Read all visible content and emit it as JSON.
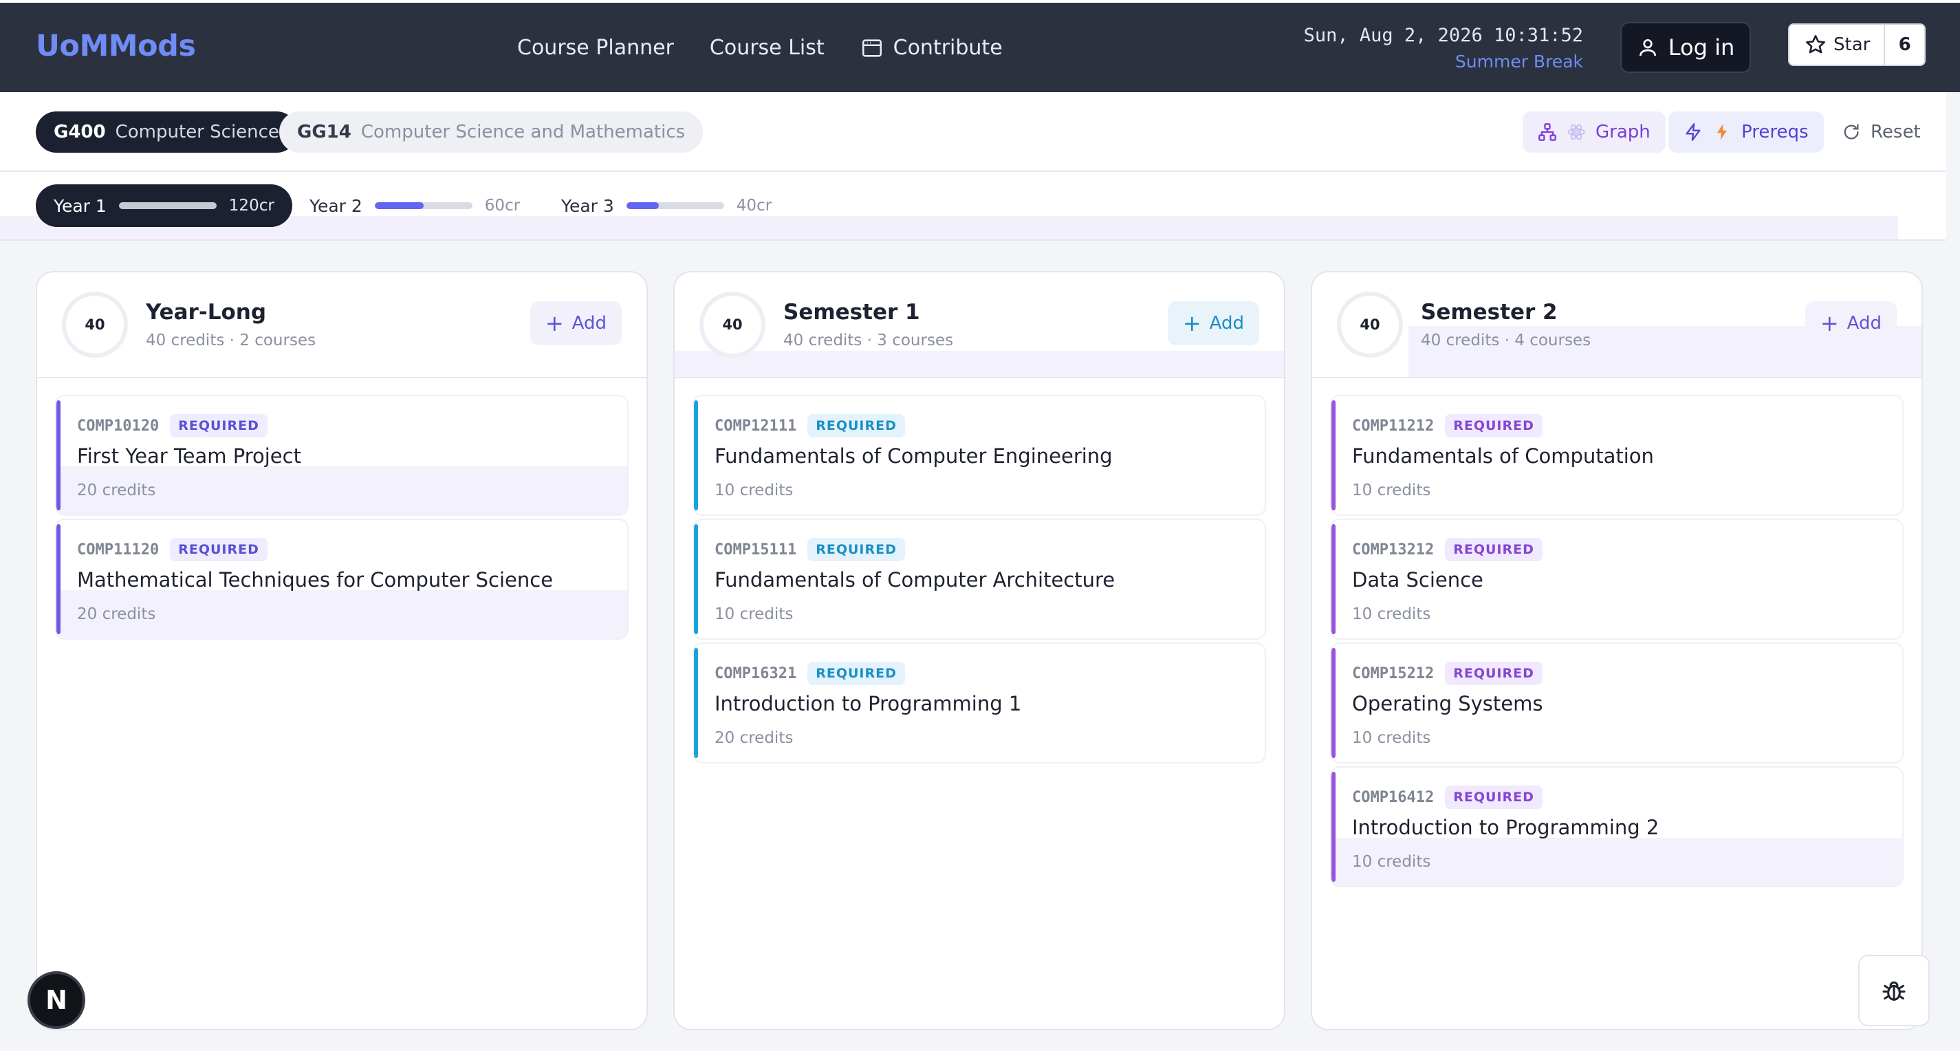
{
  "header": {
    "brand": "UoMMods",
    "nav": [
      "Course Planner",
      "Course List",
      "Contribute"
    ],
    "clock_time": "Sun, Aug 2, 2026 10:31:52",
    "term": "Summer Break",
    "login_label": "Log in",
    "star_label": "Star",
    "star_count": "6"
  },
  "programs": [
    {
      "code": "G400",
      "name": "Computer Science"
    },
    {
      "code": "GG14",
      "name": "Computer Science and Mathematics"
    }
  ],
  "tools": {
    "graph": "Graph",
    "prereqs": "Prereqs",
    "reset": "Reset"
  },
  "years": [
    {
      "label": "Year 1",
      "credits": "120cr",
      "progress": 1.0
    },
    {
      "label": "Year 2",
      "credits": "60cr",
      "progress": 0.5
    },
    {
      "label": "Year 3",
      "credits": "40cr",
      "progress": 0.33
    }
  ],
  "columns": [
    {
      "credits": "40",
      "title": "Year-Long",
      "subtitle": "40 credits · 2 courses",
      "add_label": "Add",
      "courses": [
        {
          "code": "COMP10120",
          "tag": "REQUIRED",
          "name": "First Year Team Project",
          "credits": "20 credits"
        },
        {
          "code": "COMP11120",
          "tag": "REQUIRED",
          "name": "Mathematical Techniques for Computer Science",
          "credits": "20 credits"
        }
      ]
    },
    {
      "credits": "40",
      "title": "Semester 1",
      "subtitle": "40 credits · 3 courses",
      "add_label": "Add",
      "courses": [
        {
          "code": "COMP12111",
          "tag": "REQUIRED",
          "name": "Fundamentals of Computer Engineering",
          "credits": "10 credits"
        },
        {
          "code": "COMP15111",
          "tag": "REQUIRED",
          "name": "Fundamentals of Computer Architecture",
          "credits": "10 credits"
        },
        {
          "code": "COMP16321",
          "tag": "REQUIRED",
          "name": "Introduction to Programming 1",
          "credits": "20 credits"
        }
      ]
    },
    {
      "credits": "40",
      "title": "Semester 2",
      "subtitle": "40 credits · 4 courses",
      "add_label": "Add",
      "courses": [
        {
          "code": "COMP11212",
          "tag": "REQUIRED",
          "name": "Fundamentals of Computation",
          "credits": "10 credits"
        },
        {
          "code": "COMP13212",
          "tag": "REQUIRED",
          "name": "Data Science",
          "credits": "10 credits"
        },
        {
          "code": "COMP15212",
          "tag": "REQUIRED",
          "name": "Operating Systems",
          "credits": "10 credits"
        },
        {
          "code": "COMP16412",
          "tag": "REQUIRED",
          "name": "Introduction to Programming 2",
          "credits": "10 credits"
        }
      ]
    }
  ],
  "widgets": {
    "n_badge": "N"
  },
  "colors": {
    "brand": "#6f8cf5",
    "nav_bg": "#2c3140",
    "year_long_accent": "#6b5ae6",
    "sem1_accent": "#1aa3d9",
    "sem2_accent": "#9a52e0"
  }
}
